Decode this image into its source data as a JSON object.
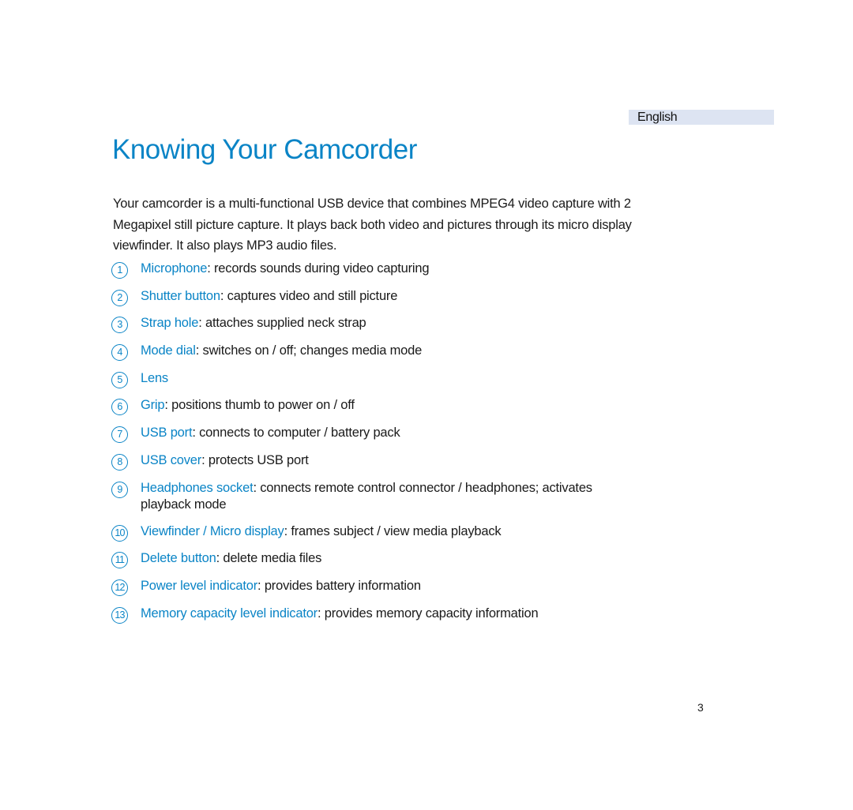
{
  "header": {
    "language": "English"
  },
  "title": "Knowing Your Camcorder",
  "intro": "Your camcorder is a multi-functional USB device that combines MPEG4 video capture with 2 Megapixel still picture capture.  It plays back both video and pictures through its micro display viewfinder.  It also plays MP3 audio files.",
  "parts": [
    {
      "number": "1",
      "term": "Microphone",
      "description": "records sounds during video capturing"
    },
    {
      "number": "2",
      "term": "Shutter button",
      "description": "captures video and still picture"
    },
    {
      "number": "3",
      "term": "Strap hole",
      "description": "attaches supplied neck strap"
    },
    {
      "number": "4",
      "term": "Mode dial",
      "description": "switches on / off; changes media mode"
    },
    {
      "number": "5",
      "term": "Lens",
      "description": ""
    },
    {
      "number": "6",
      "term": "Grip",
      "description": "positions thumb to power on / off"
    },
    {
      "number": "7",
      "term": "USB port",
      "description": "connects to computer / battery pack"
    },
    {
      "number": "8",
      "term": "USB cover",
      "description": "protects USB port"
    },
    {
      "number": "9",
      "term": "Headphones socket",
      "description": "connects remote control connector / headphones; activates playback mode"
    },
    {
      "number": "10",
      "term": "Viewfinder / Micro display",
      "description": "frames subject / view media playback"
    },
    {
      "number": "11",
      "term": "Delete button",
      "description": "delete media files"
    },
    {
      "number": "12",
      "term": "Power level indicator",
      "description": "provides battery information"
    },
    {
      "number": "13",
      "term": "Memory capacity level indicator",
      "description": "provides memory capacity information"
    }
  ],
  "colon": ": ",
  "footer": {
    "page_number": "3"
  },
  "colors": {
    "accent": "#0a84c6",
    "language_bar": "#dde4f2",
    "text": "#1a1a1a"
  }
}
